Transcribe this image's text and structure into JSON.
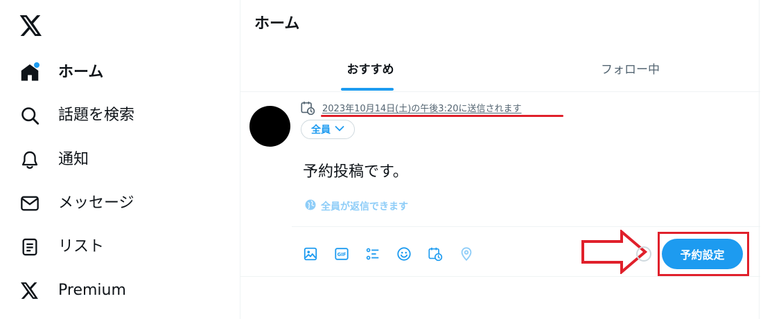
{
  "sidebar": {
    "logo": "x-logo-icon",
    "items": [
      {
        "label": "ホーム",
        "icon": "home-icon",
        "active": true,
        "has_dot": true
      },
      {
        "label": "話題を検索",
        "icon": "search-icon",
        "active": false
      },
      {
        "label": "通知",
        "icon": "bell-icon",
        "active": false
      },
      {
        "label": "メッセージ",
        "icon": "mail-icon",
        "active": false
      },
      {
        "label": "リスト",
        "icon": "list-icon",
        "active": false
      },
      {
        "label": "Premium",
        "icon": "x-logo-icon",
        "active": false
      }
    ]
  },
  "main": {
    "title": "ホーム",
    "tabs": [
      {
        "label": "おすすめ",
        "active": true
      },
      {
        "label": "フォロー中",
        "active": false
      }
    ]
  },
  "compose": {
    "schedule_text": "2023年10月14日(土)の午後3:20に送信されます",
    "audience_label": "全員",
    "post_text": "予約投稿です。",
    "reply_setting": "全員が返信できます",
    "toolbar_icons": [
      "image-icon",
      "gif-icon",
      "poll-icon",
      "emoji-icon",
      "schedule-icon",
      "location-icon"
    ],
    "schedule_button_label": "予約設定"
  },
  "colors": {
    "accent": "#1d9bf0",
    "annotation_red": "#e0202b",
    "text_primary": "#0f1419",
    "text_secondary": "#536471"
  }
}
